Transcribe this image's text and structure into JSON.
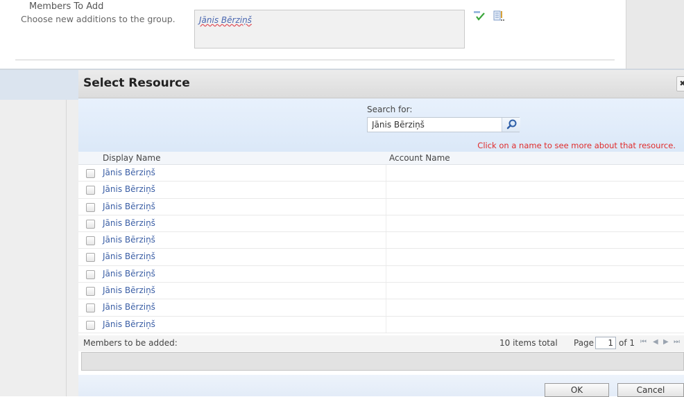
{
  "form": {
    "field_title": "Members To Add",
    "field_description": "Choose new additions to the group.",
    "resolved_member": "Jānis Bērziņš",
    "check_names_icon": "check-names-icon",
    "browse_icon": "address-book-icon"
  },
  "dialog": {
    "title": "Select Resource",
    "close_label": "✖",
    "search_label": "Search for:",
    "search_value": "Jānis Bērziņš",
    "search_icon": "magnifier-icon",
    "hint": "Click on a name to see more about that resource.",
    "columns": {
      "display_name": "Display Name",
      "account_name": "Account Name"
    },
    "rows": [
      {
        "display_name": "Jānis Bērziņš",
        "account_name": ""
      },
      {
        "display_name": "Jānis Bērziņš",
        "account_name": ""
      },
      {
        "display_name": "Jānis Bērziņš",
        "account_name": ""
      },
      {
        "display_name": "Jānis Bērziņš",
        "account_name": ""
      },
      {
        "display_name": "Jānis Bērziņš",
        "account_name": ""
      },
      {
        "display_name": "Jānis Bērziņš",
        "account_name": ""
      },
      {
        "display_name": "Jānis Bērziņš",
        "account_name": ""
      },
      {
        "display_name": "Jānis Bērziņš",
        "account_name": ""
      },
      {
        "display_name": "Jānis Bērziņš",
        "account_name": ""
      },
      {
        "display_name": "Jānis Bērziņš",
        "account_name": ""
      }
    ],
    "pager": {
      "members_label": "Members to be added:",
      "items_total": "10 items total",
      "page_label": "Page",
      "page_value": "1",
      "of_label": "of 1",
      "first_icon": "⏮",
      "prev_icon": "◀",
      "next_icon": "▶",
      "last_icon": "⏭"
    },
    "buttons": {
      "ok": "OK",
      "cancel": "Cancel"
    }
  }
}
